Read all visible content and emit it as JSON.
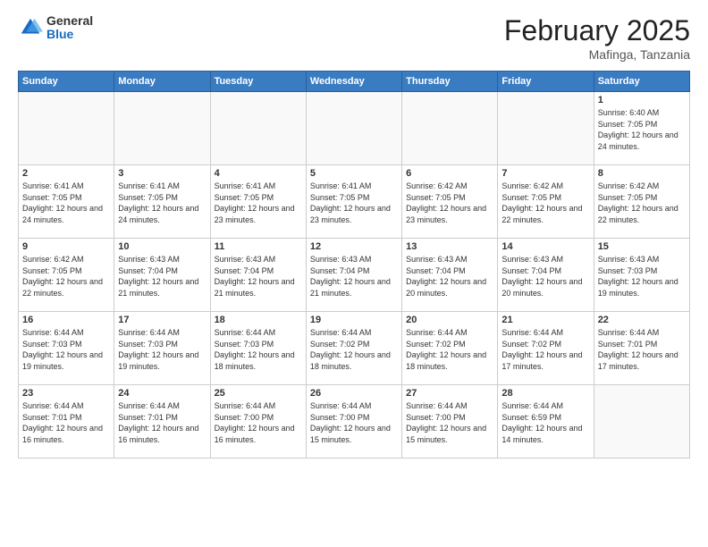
{
  "logo": {
    "general": "General",
    "blue": "Blue"
  },
  "title": "February 2025",
  "location": "Mafinga, Tanzania",
  "days_of_week": [
    "Sunday",
    "Monday",
    "Tuesday",
    "Wednesday",
    "Thursday",
    "Friday",
    "Saturday"
  ],
  "weeks": [
    [
      {
        "day": "",
        "info": ""
      },
      {
        "day": "",
        "info": ""
      },
      {
        "day": "",
        "info": ""
      },
      {
        "day": "",
        "info": ""
      },
      {
        "day": "",
        "info": ""
      },
      {
        "day": "",
        "info": ""
      },
      {
        "day": "1",
        "info": "Sunrise: 6:40 AM\nSunset: 7:05 PM\nDaylight: 12 hours and 24 minutes."
      }
    ],
    [
      {
        "day": "2",
        "info": "Sunrise: 6:41 AM\nSunset: 7:05 PM\nDaylight: 12 hours and 24 minutes."
      },
      {
        "day": "3",
        "info": "Sunrise: 6:41 AM\nSunset: 7:05 PM\nDaylight: 12 hours and 24 minutes."
      },
      {
        "day": "4",
        "info": "Sunrise: 6:41 AM\nSunset: 7:05 PM\nDaylight: 12 hours and 23 minutes."
      },
      {
        "day": "5",
        "info": "Sunrise: 6:41 AM\nSunset: 7:05 PM\nDaylight: 12 hours and 23 minutes."
      },
      {
        "day": "6",
        "info": "Sunrise: 6:42 AM\nSunset: 7:05 PM\nDaylight: 12 hours and 23 minutes."
      },
      {
        "day": "7",
        "info": "Sunrise: 6:42 AM\nSunset: 7:05 PM\nDaylight: 12 hours and 22 minutes."
      },
      {
        "day": "8",
        "info": "Sunrise: 6:42 AM\nSunset: 7:05 PM\nDaylight: 12 hours and 22 minutes."
      }
    ],
    [
      {
        "day": "9",
        "info": "Sunrise: 6:42 AM\nSunset: 7:05 PM\nDaylight: 12 hours and 22 minutes."
      },
      {
        "day": "10",
        "info": "Sunrise: 6:43 AM\nSunset: 7:04 PM\nDaylight: 12 hours and 21 minutes."
      },
      {
        "day": "11",
        "info": "Sunrise: 6:43 AM\nSunset: 7:04 PM\nDaylight: 12 hours and 21 minutes."
      },
      {
        "day": "12",
        "info": "Sunrise: 6:43 AM\nSunset: 7:04 PM\nDaylight: 12 hours and 21 minutes."
      },
      {
        "day": "13",
        "info": "Sunrise: 6:43 AM\nSunset: 7:04 PM\nDaylight: 12 hours and 20 minutes."
      },
      {
        "day": "14",
        "info": "Sunrise: 6:43 AM\nSunset: 7:04 PM\nDaylight: 12 hours and 20 minutes."
      },
      {
        "day": "15",
        "info": "Sunrise: 6:43 AM\nSunset: 7:03 PM\nDaylight: 12 hours and 19 minutes."
      }
    ],
    [
      {
        "day": "16",
        "info": "Sunrise: 6:44 AM\nSunset: 7:03 PM\nDaylight: 12 hours and 19 minutes."
      },
      {
        "day": "17",
        "info": "Sunrise: 6:44 AM\nSunset: 7:03 PM\nDaylight: 12 hours and 19 minutes."
      },
      {
        "day": "18",
        "info": "Sunrise: 6:44 AM\nSunset: 7:03 PM\nDaylight: 12 hours and 18 minutes."
      },
      {
        "day": "19",
        "info": "Sunrise: 6:44 AM\nSunset: 7:02 PM\nDaylight: 12 hours and 18 minutes."
      },
      {
        "day": "20",
        "info": "Sunrise: 6:44 AM\nSunset: 7:02 PM\nDaylight: 12 hours and 18 minutes."
      },
      {
        "day": "21",
        "info": "Sunrise: 6:44 AM\nSunset: 7:02 PM\nDaylight: 12 hours and 17 minutes."
      },
      {
        "day": "22",
        "info": "Sunrise: 6:44 AM\nSunset: 7:01 PM\nDaylight: 12 hours and 17 minutes."
      }
    ],
    [
      {
        "day": "23",
        "info": "Sunrise: 6:44 AM\nSunset: 7:01 PM\nDaylight: 12 hours and 16 minutes."
      },
      {
        "day": "24",
        "info": "Sunrise: 6:44 AM\nSunset: 7:01 PM\nDaylight: 12 hours and 16 minutes."
      },
      {
        "day": "25",
        "info": "Sunrise: 6:44 AM\nSunset: 7:00 PM\nDaylight: 12 hours and 16 minutes."
      },
      {
        "day": "26",
        "info": "Sunrise: 6:44 AM\nSunset: 7:00 PM\nDaylight: 12 hours and 15 minutes."
      },
      {
        "day": "27",
        "info": "Sunrise: 6:44 AM\nSunset: 7:00 PM\nDaylight: 12 hours and 15 minutes."
      },
      {
        "day": "28",
        "info": "Sunrise: 6:44 AM\nSunset: 6:59 PM\nDaylight: 12 hours and 14 minutes."
      },
      {
        "day": "",
        "info": ""
      }
    ]
  ]
}
